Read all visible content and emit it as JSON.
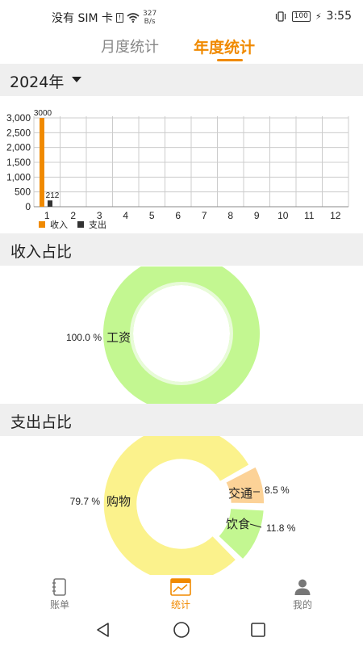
{
  "status": {
    "carrier": "没有 SIM 卡",
    "netspeed_value": "327",
    "netspeed_unit": "B/s",
    "battery": "100",
    "time": "3:55"
  },
  "tabs": [
    {
      "label": "月度统计",
      "active": false
    },
    {
      "label": "年度统计",
      "active": true
    }
  ],
  "year": "2024年",
  "chart_data": [
    {
      "type": "bar",
      "categories": [
        "1",
        "2",
        "3",
        "4",
        "5",
        "6",
        "7",
        "8",
        "9",
        "10",
        "11",
        "12"
      ],
      "series": [
        {
          "name": "收入",
          "color": "#f08a00",
          "values": [
            3000,
            0,
            0,
            0,
            0,
            0,
            0,
            0,
            0,
            0,
            0,
            0
          ],
          "labels": [
            "3000",
            "",
            "",
            "",
            "",
            "",
            "",
            "",
            "",
            "",
            "",
            ""
          ]
        },
        {
          "name": "支出",
          "color": "#333333",
          "values": [
            212,
            0,
            0,
            0,
            0,
            0,
            0,
            0,
            0,
            0,
            0,
            0
          ],
          "labels": [
            "212",
            "",
            "",
            "",
            "",
            "",
            "",
            "",
            "",
            "",
            "",
            ""
          ]
        }
      ],
      "yticks": [
        "0",
        "500",
        "1,000",
        "1,500",
        "2,000",
        "2,500",
        "3,000"
      ],
      "ylim": [
        0,
        3000
      ],
      "grid": true,
      "legend": "bottom-left"
    },
    {
      "type": "pie",
      "title": "收入占比",
      "slices": [
        {
          "label": "工资",
          "percent": "100.0 %",
          "value": 100.0,
          "color": "#c3f791"
        }
      ]
    },
    {
      "type": "pie",
      "title": "支出占比",
      "slices": [
        {
          "label": "购物",
          "percent": "79.7 %",
          "value": 79.7,
          "color": "#fbf28c"
        },
        {
          "label": "交通",
          "percent": "8.5 %",
          "value": 8.5,
          "color": "#fcd297"
        },
        {
          "label": "饮食",
          "percent": "11.8 %",
          "value": 11.8,
          "color": "#c3f791"
        }
      ]
    }
  ],
  "sections": {
    "income_title": "收入占比",
    "expense_title": "支出占比"
  },
  "nav": [
    {
      "label": "账单",
      "icon": "notebook-icon",
      "active": false
    },
    {
      "label": "统计",
      "icon": "chart-icon",
      "active": true
    },
    {
      "label": "我的",
      "icon": "person-icon",
      "active": false
    }
  ]
}
